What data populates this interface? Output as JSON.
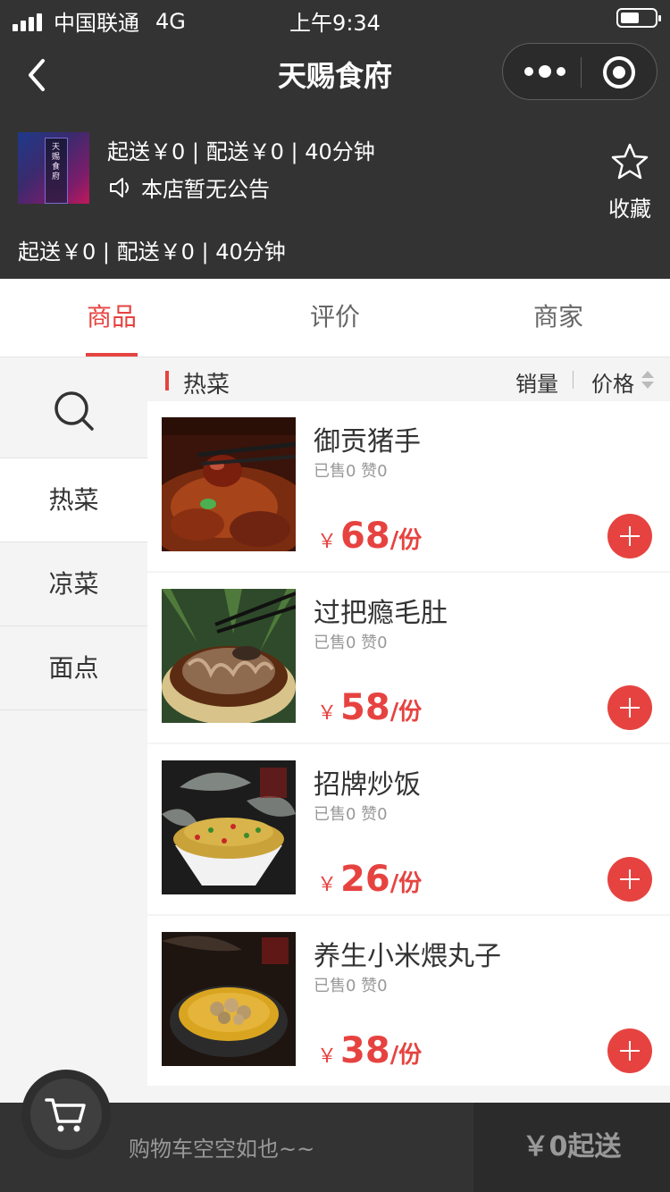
{
  "status_bar": {
    "carrier": "中国联通",
    "network": "4G",
    "time": "上午9:34"
  },
  "nav": {
    "title": "天赐食府",
    "icons": [
      "back-arrow-icon",
      "more-dots-icon",
      "target-icon"
    ]
  },
  "shop": {
    "delivery_info": "起送￥0 | 配送￥0 | 40分钟",
    "notice": "本店暂无公告",
    "favorite_label": "收藏",
    "delivery_info_repeat": "起送￥0 | 配送￥0 | 40分钟",
    "sign_text": "天赐食府"
  },
  "tabs": [
    {
      "label": "商品",
      "active": true
    },
    {
      "label": "评价",
      "active": false
    },
    {
      "label": "商家",
      "active": false
    }
  ],
  "sidebar": {
    "categories": [
      {
        "label": "热菜",
        "active": true
      },
      {
        "label": "凉菜",
        "active": false
      },
      {
        "label": "面点",
        "active": false
      }
    ]
  },
  "list_header": {
    "category": "热菜",
    "sort_sales": "销量",
    "sort_price": "价格"
  },
  "items": [
    {
      "name": "御贡猪手",
      "meta": "已售0 赞0",
      "currency": "￥",
      "price": "68",
      "unit": "/份"
    },
    {
      "name": "过把瘾毛肚",
      "meta": "已售0 赞0",
      "currency": "￥",
      "price": "58",
      "unit": "/份"
    },
    {
      "name": "招牌炒饭",
      "meta": "已售0 赞0",
      "currency": "￥",
      "price": "26",
      "unit": "/份"
    },
    {
      "name": "养生小米煨丸子",
      "meta": "已售0 赞0",
      "currency": "￥",
      "price": "38",
      "unit": "/份"
    }
  ],
  "cart": {
    "empty_text": "购物车空空如也~~",
    "submit_label": "￥0起送"
  },
  "colors": {
    "accent": "#e64340",
    "dark_bg": "#333333"
  }
}
